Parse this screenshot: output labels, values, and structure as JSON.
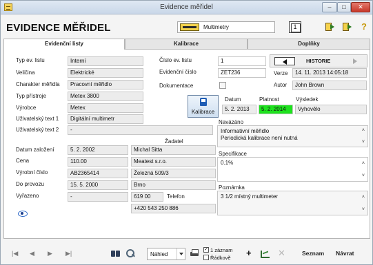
{
  "window": {
    "title": "Evidence měřidel",
    "controls": {
      "minimize": "–",
      "maximize": "□",
      "close": "✕"
    }
  },
  "header": {
    "heading": "EVIDENCE MĚŘIDEL",
    "type_combo_value": "Multimetry",
    "counter_value": "1"
  },
  "tabs": [
    {
      "label": "Evidenční listy",
      "active": true
    },
    {
      "label": "Kalibrace",
      "active": false
    },
    {
      "label": "Doplňky",
      "active": false
    }
  ],
  "left_labels": {
    "typ_ev_listu": "Typ ev. listu",
    "velicina": "Veličina",
    "charakter_meridla": "Charakter měřidla",
    "typ_pristroje": "Typ přístroje",
    "vyrobce": "Výrobce",
    "uziv_text1": "Uživatelský text 1",
    "uziv_text2": "Uživatelský text 2",
    "datum_zalozeni": "Datum založení",
    "cena": "Cena",
    "vyrobni_cislo": "Výrobní číslo",
    "do_provozu": "Do provozu",
    "vyrazeno": "Vyřazeno"
  },
  "left_values": {
    "typ_ev_listu": "Interní",
    "velicina": "Elektrické",
    "charakter_meridla": "Pracovní měřidlo",
    "typ_pristroje": "Metex 3800",
    "vyrobce": "Metex",
    "uziv_text1": "Digitální multimetr",
    "uziv_text2": "-",
    "datum_zalozeni": "5. 2. 2002",
    "cena": "110.00",
    "vyrobni_cislo": "AB2365414",
    "do_provozu": "15. 5. 2000",
    "vyrazeno": "-"
  },
  "middle": {
    "cislo_ev_listu_label": "Číslo ev. listu",
    "cislo_ev_listu_value": "1",
    "evidencni_cislo_label": "Evidenční číslo",
    "evidencni_cislo_value": "ZET236",
    "dokumentace_label": "Dokumentace"
  },
  "history": {
    "label": "HISTORIE",
    "verze_label": "Verze",
    "verze_value": "14. 11. 2013 14:05:18",
    "autor_label": "Autor",
    "autor_value": "John Brown"
  },
  "calibration": {
    "button_label": "Kalibrace",
    "datum_header": "Datum",
    "platnost_header": "Platnost",
    "vysledek_header": "Výsledek",
    "datum_value": "5. 2. 2013",
    "platnost_value": "5. 2. 2014",
    "vysledek_value": "Vyhovělo",
    "platnost_color": "#1ee21e"
  },
  "zadatel": {
    "header": "Žadatel",
    "name": "Michal Sitta",
    "company": "Meatest s.r.o.",
    "street": "Železná 509/3",
    "city": "Brno",
    "zip": "619 00",
    "telefon_label": "Telefon",
    "phone": "+420 543 250 886"
  },
  "memos": {
    "navazano_label": "Navázáno",
    "navazano_text": [
      "Informativní měřidlo",
      "Periodická kalibrace není nutná"
    ],
    "specifikace_label": "Specifikace",
    "specifikace_text": "0.1%",
    "poznamka_label": "Poznámka",
    "poznamka_text": "3 1/2 místný multimeter"
  },
  "bottom": {
    "nav_first": "|◀",
    "nav_prev": "◀",
    "nav_next": "▶",
    "nav_last": "▶|",
    "view_select": "Náhled",
    "one_record_label": "1 záznam",
    "rows_label": "Řádkově",
    "add": "+",
    "delete": "✕",
    "seznam": "Seznam",
    "navrat": "Návrat"
  }
}
